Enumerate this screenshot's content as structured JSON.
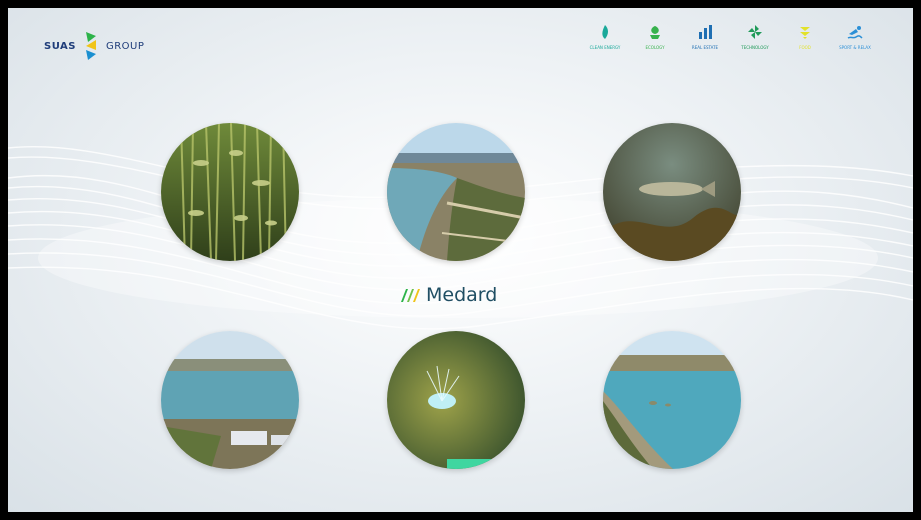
{
  "header": {
    "logo_left": "SUAS",
    "logo_right": "GROUP",
    "nav_items": [
      {
        "label": "CLEAN ENERGY",
        "icon": "flame-icon",
        "color": "#1aa99a"
      },
      {
        "label": "ECOLOGY",
        "icon": "leaf-icon",
        "color": "#37b24d"
      },
      {
        "label": "REAL ESTATE",
        "icon": "bar-chart-icon",
        "color": "#1f6fb3"
      },
      {
        "label": "TECHNOLOGY",
        "icon": "pinwheel-icon",
        "color": "#1f9a58"
      },
      {
        "label": "FOOD",
        "icon": "wheat-icon",
        "color": "#e2e22a"
      },
      {
        "label": "SPORT & RELAX",
        "icon": "swimmer-icon",
        "color": "#2b8fd6"
      }
    ]
  },
  "main": {
    "brand_name": "Medard",
    "brand_icon": "medard-logo-icon",
    "brand_colors": [
      "#2db34a",
      "#f0c419"
    ],
    "tiles": [
      {
        "name": "underwater-reeds-fish-photo"
      },
      {
        "name": "aerial-lake-shore-photo"
      },
      {
        "name": "underwater-pike-fish-photo"
      },
      {
        "name": "aerial-lake-industrial-photo"
      },
      {
        "name": "underwater-spring-photo"
      },
      {
        "name": "aerial-lake-peninsula-photo"
      }
    ]
  }
}
